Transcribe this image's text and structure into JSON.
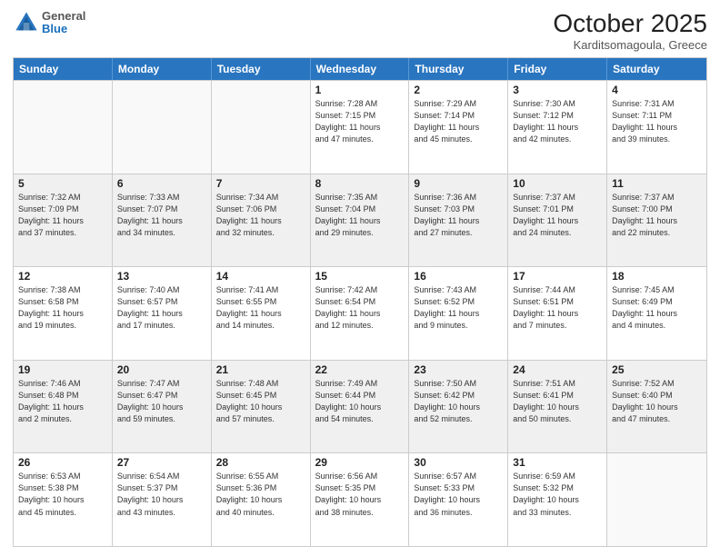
{
  "logo": {
    "general": "General",
    "blue": "Blue"
  },
  "title": {
    "month": "October 2025",
    "location": "Karditsomagoula, Greece"
  },
  "headers": [
    "Sunday",
    "Monday",
    "Tuesday",
    "Wednesday",
    "Thursday",
    "Friday",
    "Saturday"
  ],
  "weeks": [
    [
      {
        "day": "",
        "info": ""
      },
      {
        "day": "",
        "info": ""
      },
      {
        "day": "",
        "info": ""
      },
      {
        "day": "1",
        "info": "Sunrise: 7:28 AM\nSunset: 7:15 PM\nDaylight: 11 hours\nand 47 minutes."
      },
      {
        "day": "2",
        "info": "Sunrise: 7:29 AM\nSunset: 7:14 PM\nDaylight: 11 hours\nand 45 minutes."
      },
      {
        "day": "3",
        "info": "Sunrise: 7:30 AM\nSunset: 7:12 PM\nDaylight: 11 hours\nand 42 minutes."
      },
      {
        "day": "4",
        "info": "Sunrise: 7:31 AM\nSunset: 7:11 PM\nDaylight: 11 hours\nand 39 minutes."
      }
    ],
    [
      {
        "day": "5",
        "info": "Sunrise: 7:32 AM\nSunset: 7:09 PM\nDaylight: 11 hours\nand 37 minutes."
      },
      {
        "day": "6",
        "info": "Sunrise: 7:33 AM\nSunset: 7:07 PM\nDaylight: 11 hours\nand 34 minutes."
      },
      {
        "day": "7",
        "info": "Sunrise: 7:34 AM\nSunset: 7:06 PM\nDaylight: 11 hours\nand 32 minutes."
      },
      {
        "day": "8",
        "info": "Sunrise: 7:35 AM\nSunset: 7:04 PM\nDaylight: 11 hours\nand 29 minutes."
      },
      {
        "day": "9",
        "info": "Sunrise: 7:36 AM\nSunset: 7:03 PM\nDaylight: 11 hours\nand 27 minutes."
      },
      {
        "day": "10",
        "info": "Sunrise: 7:37 AM\nSunset: 7:01 PM\nDaylight: 11 hours\nand 24 minutes."
      },
      {
        "day": "11",
        "info": "Sunrise: 7:37 AM\nSunset: 7:00 PM\nDaylight: 11 hours\nand 22 minutes."
      }
    ],
    [
      {
        "day": "12",
        "info": "Sunrise: 7:38 AM\nSunset: 6:58 PM\nDaylight: 11 hours\nand 19 minutes."
      },
      {
        "day": "13",
        "info": "Sunrise: 7:40 AM\nSunset: 6:57 PM\nDaylight: 11 hours\nand 17 minutes."
      },
      {
        "day": "14",
        "info": "Sunrise: 7:41 AM\nSunset: 6:55 PM\nDaylight: 11 hours\nand 14 minutes."
      },
      {
        "day": "15",
        "info": "Sunrise: 7:42 AM\nSunset: 6:54 PM\nDaylight: 11 hours\nand 12 minutes."
      },
      {
        "day": "16",
        "info": "Sunrise: 7:43 AM\nSunset: 6:52 PM\nDaylight: 11 hours\nand 9 minutes."
      },
      {
        "day": "17",
        "info": "Sunrise: 7:44 AM\nSunset: 6:51 PM\nDaylight: 11 hours\nand 7 minutes."
      },
      {
        "day": "18",
        "info": "Sunrise: 7:45 AM\nSunset: 6:49 PM\nDaylight: 11 hours\nand 4 minutes."
      }
    ],
    [
      {
        "day": "19",
        "info": "Sunrise: 7:46 AM\nSunset: 6:48 PM\nDaylight: 11 hours\nand 2 minutes."
      },
      {
        "day": "20",
        "info": "Sunrise: 7:47 AM\nSunset: 6:47 PM\nDaylight: 10 hours\nand 59 minutes."
      },
      {
        "day": "21",
        "info": "Sunrise: 7:48 AM\nSunset: 6:45 PM\nDaylight: 10 hours\nand 57 minutes."
      },
      {
        "day": "22",
        "info": "Sunrise: 7:49 AM\nSunset: 6:44 PM\nDaylight: 10 hours\nand 54 minutes."
      },
      {
        "day": "23",
        "info": "Sunrise: 7:50 AM\nSunset: 6:42 PM\nDaylight: 10 hours\nand 52 minutes."
      },
      {
        "day": "24",
        "info": "Sunrise: 7:51 AM\nSunset: 6:41 PM\nDaylight: 10 hours\nand 50 minutes."
      },
      {
        "day": "25",
        "info": "Sunrise: 7:52 AM\nSunset: 6:40 PM\nDaylight: 10 hours\nand 47 minutes."
      }
    ],
    [
      {
        "day": "26",
        "info": "Sunrise: 6:53 AM\nSunset: 5:38 PM\nDaylight: 10 hours\nand 45 minutes."
      },
      {
        "day": "27",
        "info": "Sunrise: 6:54 AM\nSunset: 5:37 PM\nDaylight: 10 hours\nand 43 minutes."
      },
      {
        "day": "28",
        "info": "Sunrise: 6:55 AM\nSunset: 5:36 PM\nDaylight: 10 hours\nand 40 minutes."
      },
      {
        "day": "29",
        "info": "Sunrise: 6:56 AM\nSunset: 5:35 PM\nDaylight: 10 hours\nand 38 minutes."
      },
      {
        "day": "30",
        "info": "Sunrise: 6:57 AM\nSunset: 5:33 PM\nDaylight: 10 hours\nand 36 minutes."
      },
      {
        "day": "31",
        "info": "Sunrise: 6:59 AM\nSunset: 5:32 PM\nDaylight: 10 hours\nand 33 minutes."
      },
      {
        "day": "",
        "info": ""
      }
    ]
  ]
}
